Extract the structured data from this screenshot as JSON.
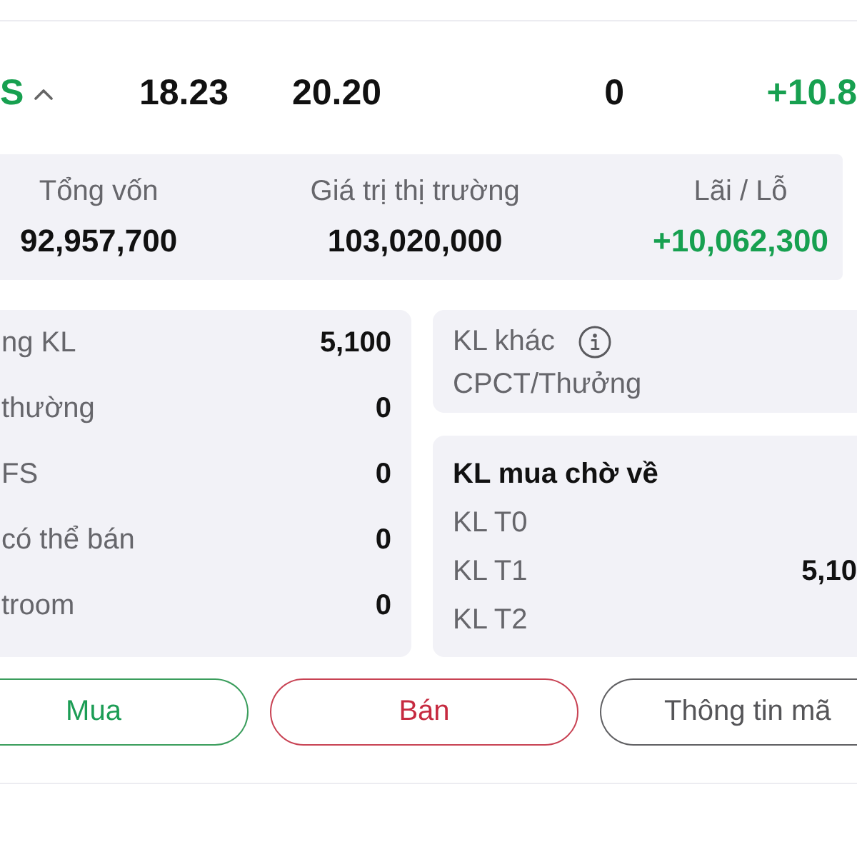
{
  "position_row": {
    "symbol": "S",
    "positive": true,
    "expanded": true,
    "values": [
      "18.23",
      "20.20",
      "0"
    ],
    "change": "+10.8"
  },
  "summary": [
    {
      "label": "Tổng vốn",
      "value": "92,957,700",
      "positive": false
    },
    {
      "label": "Giá trị thị trường",
      "value": "103,020,000",
      "positive": false
    },
    {
      "label": "Lãi / Lỗ",
      "value": "+10,062,300",
      "positive": true
    }
  ],
  "holdings": [
    {
      "label": "ng KL",
      "value": "5,100"
    },
    {
      "label": "thường",
      "value": "0"
    },
    {
      "label": "FS",
      "value": "0"
    },
    {
      "label": "có thể bán",
      "value": "0"
    },
    {
      "label": "troom",
      "value": "0"
    }
  ],
  "other_volume": {
    "label": "KL khác",
    "note": "CPCT/Thưởng"
  },
  "pending_buy": {
    "title": "KL mua chờ về",
    "rows": [
      {
        "label": "KL T0"
      },
      {
        "label": "KL T1",
        "value": "5,10"
      },
      {
        "label": "KL T2"
      }
    ]
  },
  "actions": [
    {
      "label": "Mua",
      "kind": "buy"
    },
    {
      "label": "Bán",
      "kind": "sell"
    },
    {
      "label": "Thông tin mã",
      "kind": "info"
    }
  ]
}
